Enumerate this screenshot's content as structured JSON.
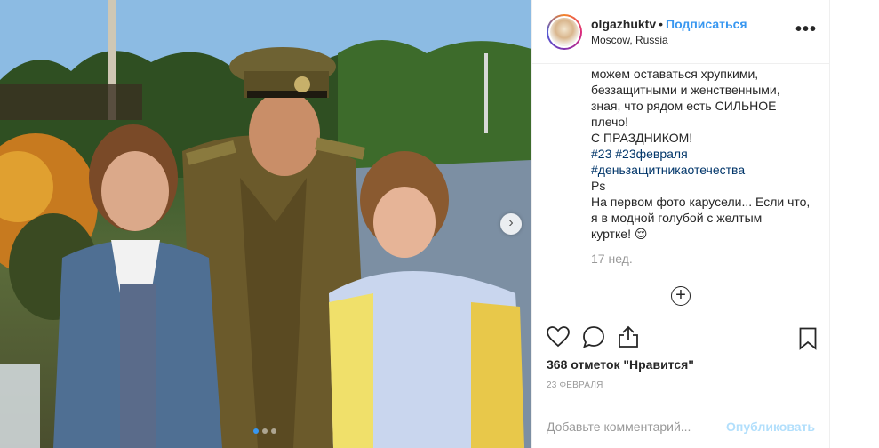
{
  "post": {
    "username": "olgazhuktv",
    "separator": "•",
    "follow_label": "Подписаться",
    "location": "Moscow, Russia",
    "more_label": "•••"
  },
  "caption": {
    "lines": [
      "можем оставаться хрупкими,",
      "беззащитными и женственными,",
      "зная, что рядом есть СИЛЬНОЕ",
      "плечо!",
      "С ПРАЗДНИКОМ!"
    ],
    "hashtags_1": "#23 #23февраля",
    "hashtags_2": "#деньзащитникаотечества",
    "ps": "Ps",
    "ps_lines": [
      "На первом фото карусели... Если что,",
      "я в модной голубой с желтым",
      "куртке! 😌"
    ],
    "time_ago": "17 нед.",
    "load_more": "+"
  },
  "actions": {
    "likes": "368 отметок \"Нравится\"",
    "date": "23 ФЕВРАЛЯ",
    "icons": [
      "heart-icon",
      "comment-icon",
      "share-icon",
      "bookmark-icon"
    ]
  },
  "comment": {
    "placeholder": "Добавьте комментарий...",
    "publish_label": "Опубликовать"
  },
  "carousel": {
    "next_label": "›",
    "dots_total": 3,
    "active_dot": 1
  },
  "colors": {
    "accent": "#3897f0",
    "hashtag": "#003569",
    "muted": "#999999",
    "publish_disabled": "#b2dffc"
  }
}
